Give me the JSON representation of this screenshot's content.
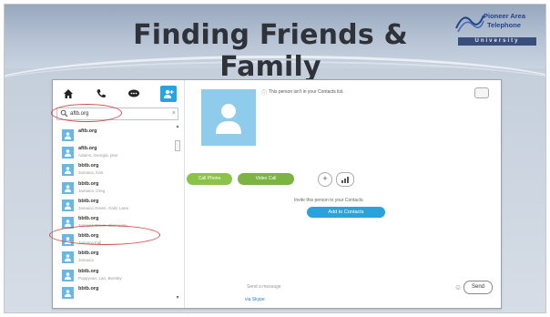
{
  "slide": {
    "title": "Finding Friends & Family",
    "logo": {
      "line1": "Pioneer Area",
      "line2": "Telephone",
      "line3": "University",
      "logo_icon": "wave-icon"
    },
    "colors": {
      "banner": "#97a7bd",
      "title_text": "#2f3339",
      "logo_blue": "#24448a",
      "highlight_circle": "#d24a4a"
    }
  },
  "app": {
    "nav": {
      "home_icon": "home-icon",
      "phone_icon": "phone-icon",
      "chat_icon": "chat-bubble-icon",
      "contacts_icon": "add-contact-icon"
    },
    "search": {
      "value": "aftb.org"
    },
    "contacts": [
      {
        "name": "aftb.org",
        "sub": ""
      },
      {
        "name": "aftb.org",
        "sub": "Adams, Georgia, plus"
      },
      {
        "name": "bbtb.org",
        "sub": "Jamaica, Kan"
      },
      {
        "name": "bbtb.org",
        "sub": "Jamaica, Oreg"
      },
      {
        "name": "bbtb.org",
        "sub": "Jamaica Green, Gold, Lane"
      },
      {
        "name": "bbtb.org",
        "sub": "Jamaica Green, Glen Lane"
      },
      {
        "name": "bbtb.org",
        "sub": "Jamaica Fall"
      },
      {
        "name": "bbtb.org",
        "sub": "Jamaica"
      },
      {
        "name": "bbtb.org",
        "sub": "Poppyvan, Lan, Bentley"
      },
      {
        "name": "bbtb.org",
        "sub": ""
      }
    ],
    "profile": {
      "notice": "This person isn't in your Contacts list.",
      "call_button": "Call Phone",
      "video_button": "Video Call",
      "add_icon": "plus-icon",
      "invite_text": "Invite this person to your Contacts",
      "add_to_contacts": "Add to Contacts",
      "bottom_text": "Send a message",
      "send_label": "Send",
      "skype_link": "via Skype"
    },
    "colors": {
      "accent_blue": "#27a3df",
      "call_green": "#8bc34a",
      "avatar_blue": "#69b7e3"
    }
  }
}
